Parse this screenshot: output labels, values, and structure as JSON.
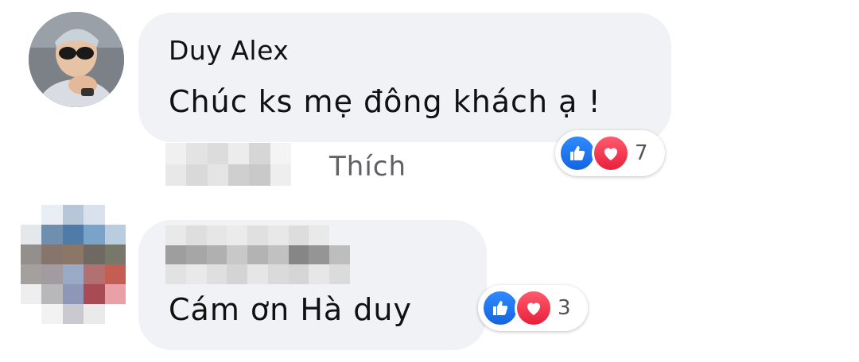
{
  "comments": [
    {
      "author": "Duy Alex",
      "text": "Chúc ks mẹ đông khách ạ !",
      "like_action": "Thích",
      "reaction_count": "7",
      "reactions": [
        "like-icon",
        "love-icon"
      ]
    },
    {
      "author": "",
      "text": "Cám ơn Hà duy",
      "reaction_count": "3",
      "reactions": [
        "like-icon",
        "love-icon"
      ]
    }
  ],
  "colors": {
    "bubble": "#f0f2f5",
    "like_blue": "#1877f2",
    "love_red": "#f33e58",
    "action_gray": "#65676b"
  }
}
